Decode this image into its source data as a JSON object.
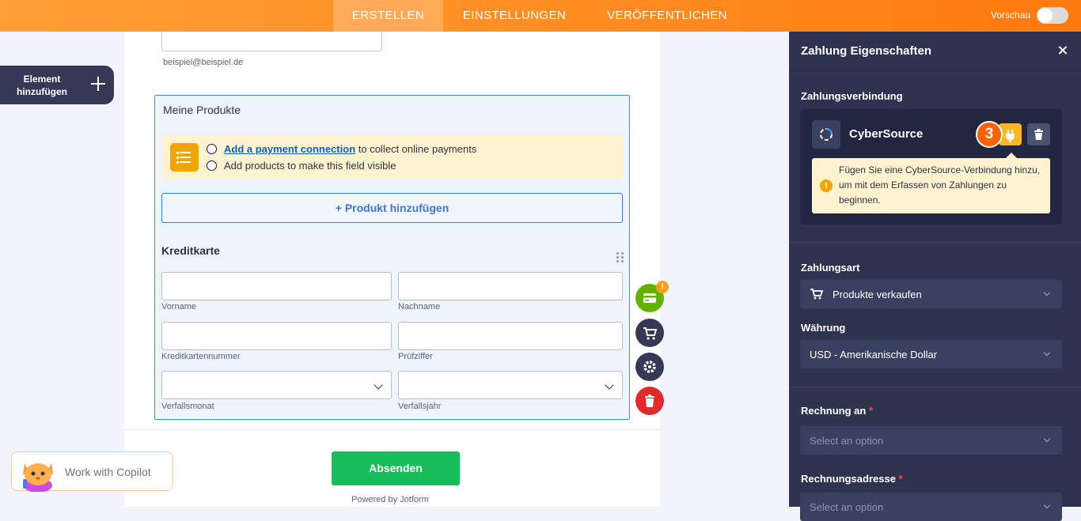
{
  "topbar": {
    "tabs": [
      {
        "label": "ERSTELLEN",
        "active": true
      },
      {
        "label": "EINSTELLUNGEN",
        "active": false
      },
      {
        "label": "VERÖFFENTLICHEN",
        "active": false
      }
    ],
    "preview_label": "Vorschau",
    "preview_enabled": false,
    "accent_color": "#ff8b1f"
  },
  "sidebar": {
    "add_element_label": "Element hinzufügen"
  },
  "form": {
    "email_sublabel": "beispiel@beispiel.de",
    "products": {
      "title": "Meine Produkte",
      "notice": {
        "link": "Add a payment connection",
        "line1_rest": " to collect online payments",
        "line2": "Add products to make this field visible"
      },
      "add_product_button": "+ Produkt hinzufügen"
    },
    "credit_card": {
      "title": "Kreditkarte",
      "fields": {
        "first_name": "Vorname",
        "last_name": "Nachname",
        "card_number": "Kreditkartennummer",
        "cvv": "Prüfziffer",
        "exp_month": "Verfallsmonat",
        "exp_year": "Verfallsjahr"
      }
    },
    "tool_badge": "!",
    "submit_label": "Absenden",
    "powered_by": "Powered by Jotform"
  },
  "copilot": {
    "label": "Work with Copilot"
  },
  "panel": {
    "title": "Zahlung Eigenschaften",
    "connection_label": "Zahlungsverbindung",
    "gateway_name": "CyberSource",
    "step_badge": "3",
    "warning_text": "Fügen Sie eine CyberSource-Verbindung hinzu, um mit dem Erfassen von Zahlungen zu beginnen.",
    "payment_type_label": "Zahlungsart",
    "payment_type_value": "Produkte verkaufen",
    "currency_label": "Währung",
    "currency_value": "USD - Amerikanische Dollar",
    "invoice_to_label": "Rechnung an",
    "invoice_to_placeholder": "Select an option",
    "billing_address_label": "Rechnungsadresse",
    "billing_address_placeholder": "Select an option",
    "required_mark": "*"
  }
}
